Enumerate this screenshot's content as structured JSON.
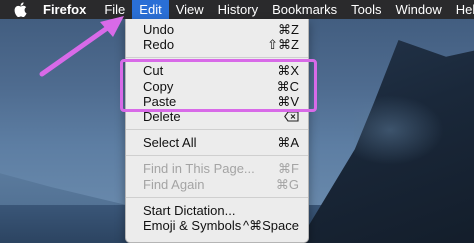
{
  "menubar": {
    "apple_icon": "apple-icon",
    "items": [
      {
        "label": "Firefox"
      },
      {
        "label": "File"
      },
      {
        "label": "Edit"
      },
      {
        "label": "View"
      },
      {
        "label": "History"
      },
      {
        "label": "Bookmarks"
      },
      {
        "label": "Tools"
      },
      {
        "label": "Window"
      },
      {
        "label": "Help"
      }
    ],
    "active_item": "Edit"
  },
  "edit_menu": {
    "items": [
      {
        "label": "Undo",
        "shortcut": "⌘Z",
        "enabled": true
      },
      {
        "label": "Redo",
        "shortcut": "⇧⌘Z",
        "enabled": true
      },
      {
        "label": "Cut",
        "shortcut": "⌘X",
        "enabled": true
      },
      {
        "label": "Copy",
        "shortcut": "⌘C",
        "enabled": true
      },
      {
        "label": "Paste",
        "shortcut": "⌘V",
        "enabled": true
      },
      {
        "label": "Delete",
        "shortcut_icon": "delete-key-icon",
        "enabled": true
      },
      {
        "label": "Select All",
        "shortcut": "⌘A",
        "enabled": true
      },
      {
        "label": "Find in This Page...",
        "shortcut": "⌘F",
        "enabled": false
      },
      {
        "label": "Find Again",
        "shortcut": "⌘G",
        "enabled": false
      },
      {
        "label": "Start Dictation...",
        "shortcut": "",
        "enabled": true
      },
      {
        "label": "Emoji & Symbols",
        "shortcut": "^⌘Space",
        "enabled": true
      }
    ]
  },
  "annotation": {
    "highlight_color": "#d86ae8",
    "highlighted_items": [
      "Cut",
      "Copy",
      "Paste"
    ],
    "arrow_target": "Edit"
  },
  "colors": {
    "menubar_bg": "#2a2a2c",
    "active_menu_bg": "#2a6fd6",
    "menu_bg": "#ececec"
  }
}
